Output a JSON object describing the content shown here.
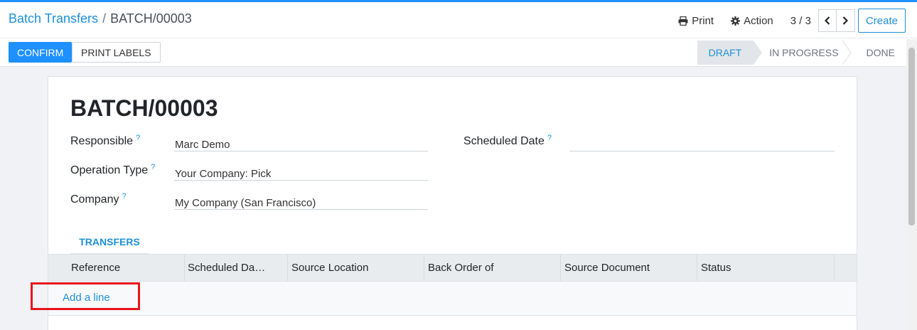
{
  "breadcrumb": {
    "parent": "Batch Transfers",
    "separator": "/",
    "current": "BATCH/00003"
  },
  "toolbar": {
    "print": "Print",
    "action": "Action",
    "pager": "3 / 3",
    "create": "Create"
  },
  "buttons": {
    "confirm": "CONFIRM",
    "print_labels": "PRINT LABELS"
  },
  "status": {
    "stages": [
      "DRAFT",
      "IN PROGRESS",
      "DONE"
    ],
    "active": "DRAFT"
  },
  "record": {
    "title": "BATCH/00003",
    "fields": {
      "responsible": {
        "label": "Responsible",
        "value": "Marc Demo"
      },
      "operation_type": {
        "label": "Operation Type",
        "value": "Your Company: Pick"
      },
      "company": {
        "label": "Company",
        "value": "My Company (San Francisco)"
      },
      "scheduled_date": {
        "label": "Scheduled Date",
        "value": ""
      }
    },
    "help_mark": "?"
  },
  "tabs": {
    "transfers": "TRANSFERS"
  },
  "table": {
    "columns": [
      "Reference",
      "Scheduled Da…",
      "Source Location",
      "Back Order of",
      "Source Document",
      "Status"
    ],
    "add_line": "Add a line"
  },
  "colors": {
    "primary": "#1e90ff",
    "link": "#1e90d6",
    "highlight": "#e8141c"
  }
}
